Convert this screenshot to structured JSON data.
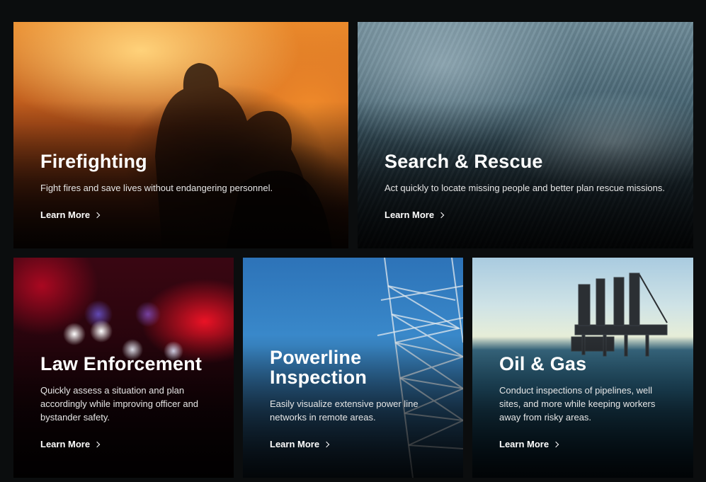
{
  "cards": [
    {
      "id": "firefighting",
      "title": "Firefighting",
      "description": "Fight fires and save lives without endangering personnel.",
      "link_label": "Learn More"
    },
    {
      "id": "search-rescue",
      "title": "Search & Rescue",
      "description": "Act quickly to locate missing people and better plan rescue missions.",
      "link_label": "Learn More"
    },
    {
      "id": "law-enforcement",
      "title": "Law Enforcement",
      "description": "Quickly assess a situation and plan accordingly while improving officer and bystander safety.",
      "link_label": "Learn More"
    },
    {
      "id": "powerline-inspection",
      "title": "Powerline Inspection",
      "description": "Easily visualize extensive power line networks in remote areas.",
      "link_label": "Learn More"
    },
    {
      "id": "oil-gas",
      "title": "Oil & Gas",
      "description": "Conduct inspections of pipelines, well sites, and more while keeping workers away from risky areas.",
      "link_label": "Learn More"
    }
  ],
  "icons": {
    "link": "chevron-right-icon"
  },
  "colors": {
    "page_background": "#0b0d0e",
    "text": "#ffffff"
  }
}
